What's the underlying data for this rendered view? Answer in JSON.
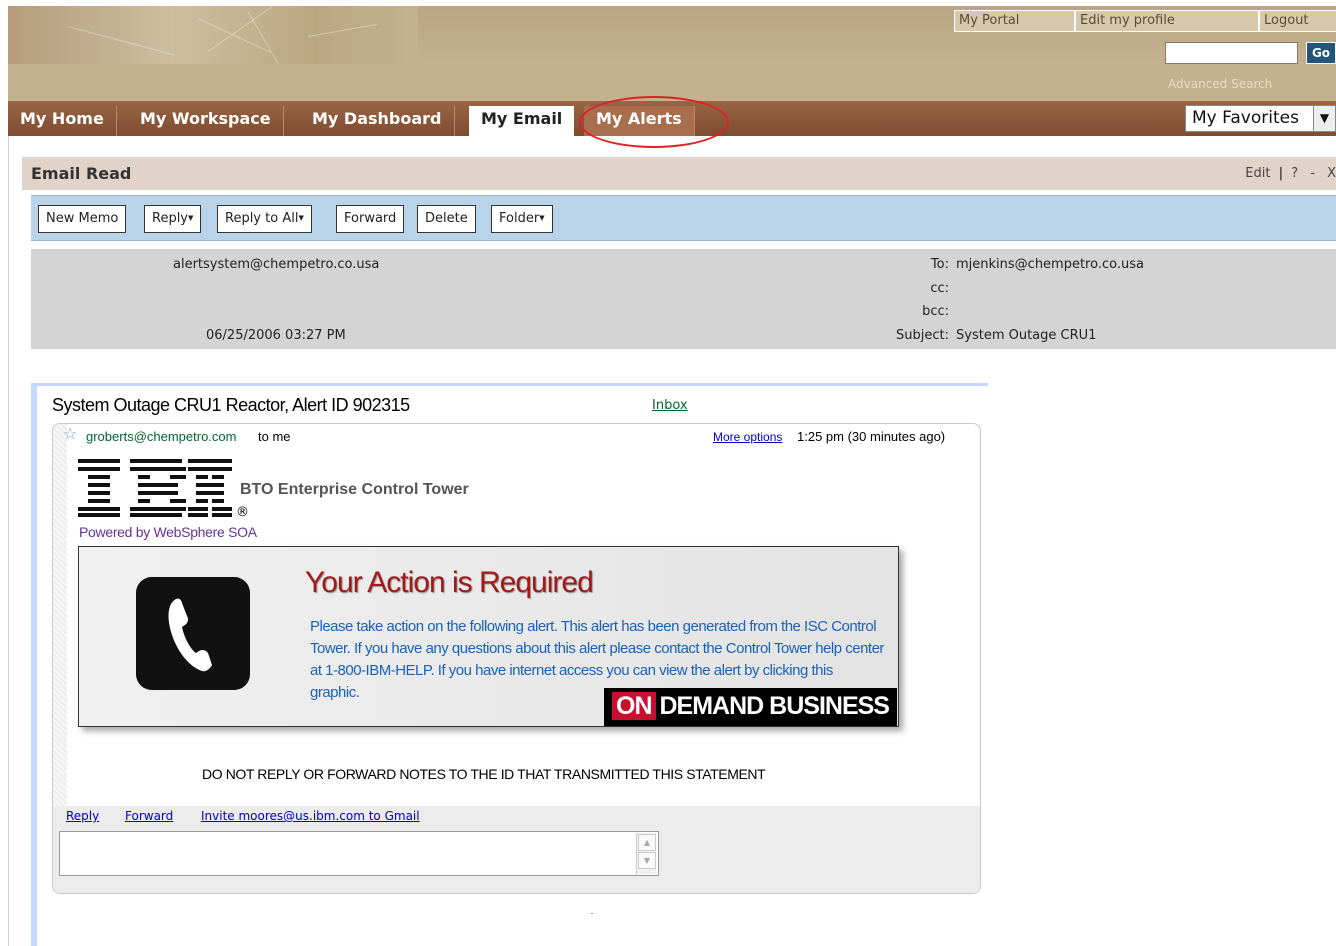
{
  "header": {
    "links": [
      "My Portal",
      "Edit my profile",
      "Logout"
    ],
    "search_placeholder": "",
    "go_label": "Go",
    "advanced_search": "Advanced Search"
  },
  "tabs": [
    {
      "label": "My Home"
    },
    {
      "label": "My Workspace"
    },
    {
      "label": "My Dashboard"
    },
    {
      "label": "My Email",
      "active": true
    },
    {
      "label": "My Alerts",
      "highlighted": true
    }
  ],
  "favorites": {
    "selected": "My Favorites"
  },
  "portlet": {
    "title": "Email Read",
    "edit": "Edit",
    "help": "?",
    "minimize": "-",
    "close": "X"
  },
  "toolbar": {
    "new_memo": "New Memo",
    "reply": "Reply",
    "reply_all": "Reply to All",
    "forward": "Forward",
    "delete": "Delete",
    "folder": "Folder"
  },
  "message_header": {
    "from": "alertsystem@chempetro.co.usa",
    "date": "06/25/2006 03:27 PM",
    "to_label": "To:",
    "to": "mjenkins@chempetro.co.usa",
    "cc_label": "cc:",
    "cc": "",
    "bcc_label": "bcc:",
    "bcc": "",
    "subject_label": "Subject:",
    "subject": "System Outage CRU1"
  },
  "gmail": {
    "subject": "System Outage CRU1 Reactor, Alert ID 902315",
    "inbox_label": "Inbox",
    "from": "groberts@chempetro.com",
    "to_me": "to me",
    "more_options": "More options",
    "time": "1:25 pm (30 minutes ago)",
    "reply": "Reply",
    "forward": "Forward",
    "invite": "Invite moores@us.ibm.com to Gmail"
  },
  "alert_body": {
    "ibm_title": "BTO Enterprise Control Tower",
    "reg_mark": "®",
    "powered_by": "Powered by WebSphere SOA",
    "action_title": "Your Action is Required",
    "action_text": "Please take action on the following alert. This alert has been generated from the ISC Control Tower. If you have any questions about this alert please contact the Control Tower help center at 1-800-IBM-HELP. If you have internet access you can view the alert by clicking this graphic.",
    "badge_on": "ON",
    "badge_text": "DEMAND BUSINESS",
    "no_reply_notice": "DO NOT REPLY OR FORWARD NOTES TO THE ID THAT TRANSMITTED THIS STATEMENT"
  },
  "colors": {
    "tab_bar": "#8f5a3c",
    "toolbar": "#b9d3e8",
    "action_title": "#a11a1a",
    "action_text": "#1a62b8",
    "highlight_circle": "#dd2222"
  }
}
